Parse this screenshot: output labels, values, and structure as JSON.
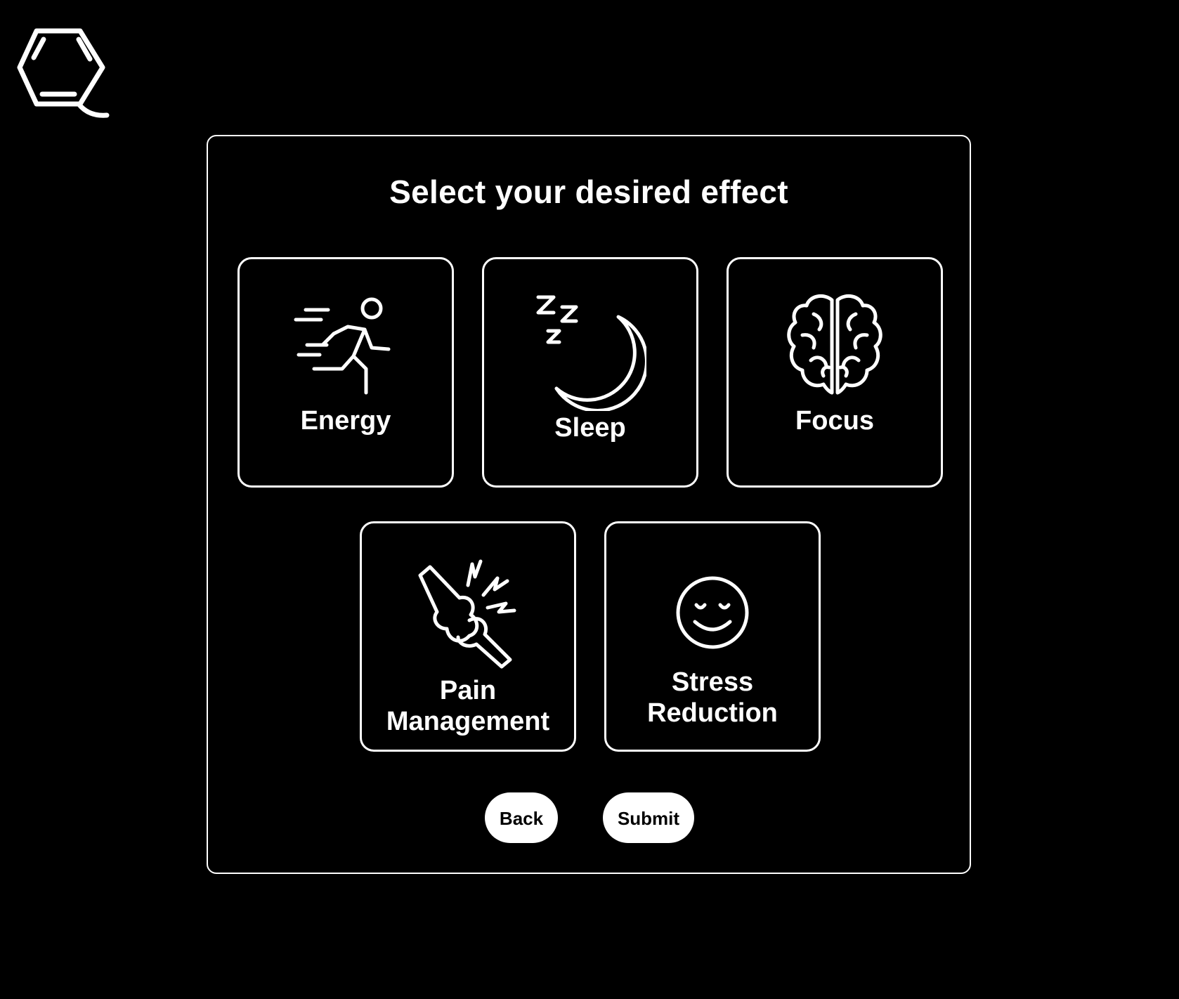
{
  "logo": {
    "icon": "hexagon-q-logo"
  },
  "page": {
    "title": "Select your desired effect"
  },
  "effects": [
    {
      "label_lines": [
        "Energy"
      ],
      "icon": "running-person-icon"
    },
    {
      "label_lines": [
        "Sleep"
      ],
      "icon": "moon-zzz-icon"
    },
    {
      "label_lines": [
        "Focus"
      ],
      "icon": "brain-icon"
    },
    {
      "label_lines": [
        "Pain",
        "Management"
      ],
      "icon": "joint-pain-icon"
    },
    {
      "label_lines": [
        "Stress",
        "Reduction"
      ],
      "icon": "smiley-face-icon"
    }
  ],
  "buttons": {
    "back": "Back",
    "submit": "Submit"
  }
}
